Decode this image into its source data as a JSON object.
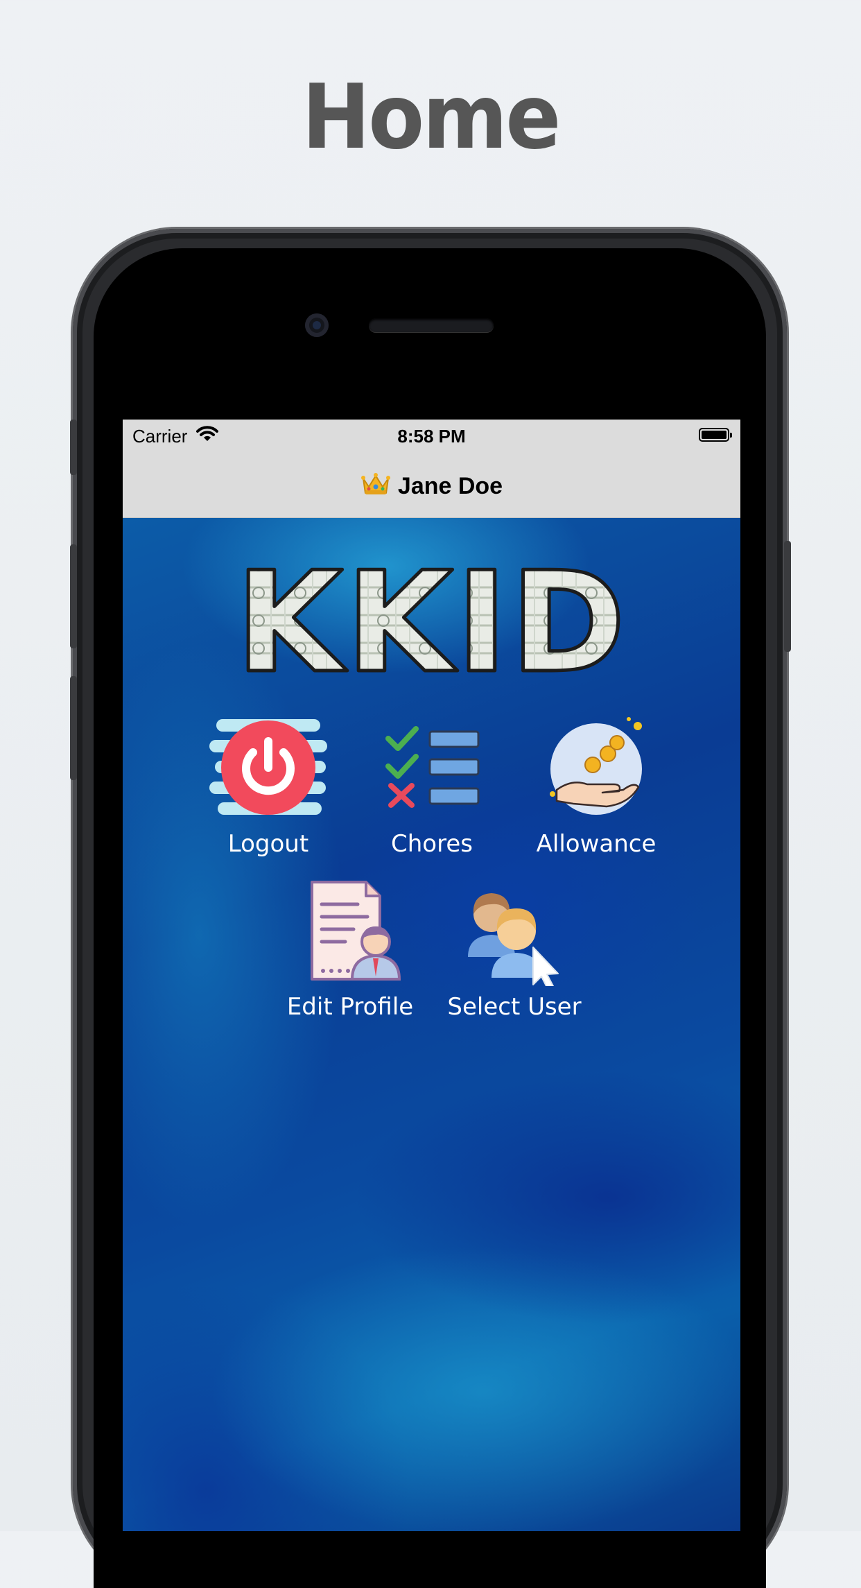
{
  "header": {
    "title": "Home"
  },
  "status_bar": {
    "carrier": "Carrier",
    "time": "8:58 PM",
    "wifi_icon": "wifi-icon",
    "battery_icon": "battery-icon"
  },
  "nav": {
    "icon": "crown-icon",
    "title": "Jane Doe"
  },
  "logo": {
    "text": "KKID"
  },
  "menu": {
    "items": [
      {
        "label": "Logout",
        "icon": "power-icon"
      },
      {
        "label": "Chores",
        "icon": "checklist-icon"
      },
      {
        "label": "Allowance",
        "icon": "coins-hand-icon"
      },
      {
        "label": "Edit Profile",
        "icon": "profile-document-icon"
      },
      {
        "label": "Select User",
        "icon": "users-cursor-icon"
      }
    ]
  },
  "colors": {
    "accent_red": "#f24a5c",
    "background_blue": "#0a3e8e",
    "navbar_gray": "#dcdcdc",
    "title_gray": "#565656"
  }
}
